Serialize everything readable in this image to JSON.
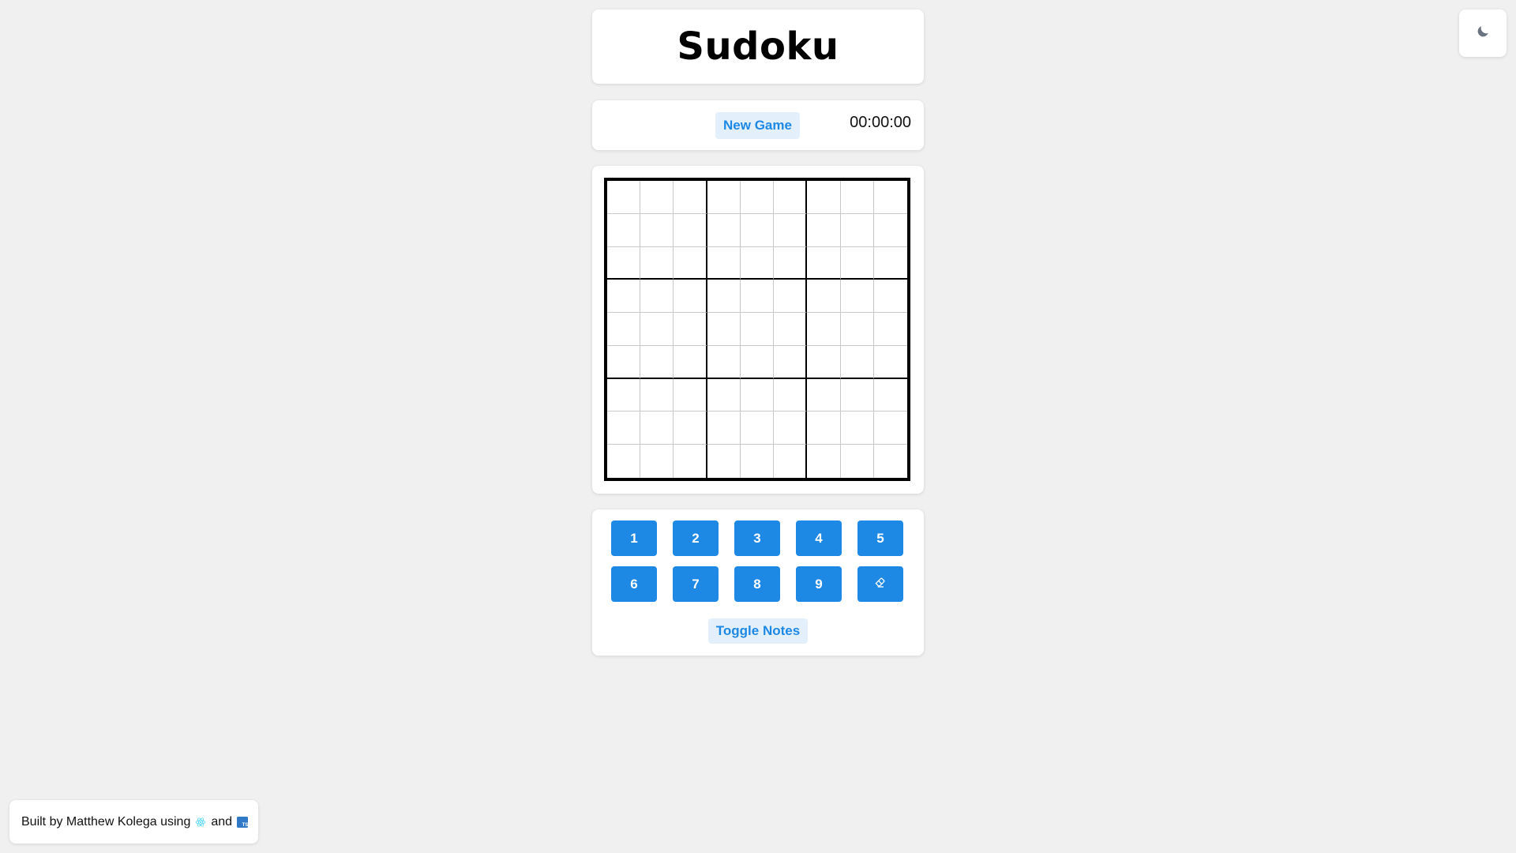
{
  "title": "Sudoku",
  "controls": {
    "new_game_label": "New Game",
    "timer": "00:00:00"
  },
  "board": {
    "size": 9,
    "cells": [
      [
        "",
        "",
        "",
        "",
        "",
        "",
        "",
        "",
        ""
      ],
      [
        "",
        "",
        "",
        "",
        "",
        "",
        "",
        "",
        ""
      ],
      [
        "",
        "",
        "",
        "",
        "",
        "",
        "",
        "",
        ""
      ],
      [
        "",
        "",
        "",
        "",
        "",
        "",
        "",
        "",
        ""
      ],
      [
        "",
        "",
        "",
        "",
        "",
        "",
        "",
        "",
        ""
      ],
      [
        "",
        "",
        "",
        "",
        "",
        "",
        "",
        "",
        ""
      ],
      [
        "",
        "",
        "",
        "",
        "",
        "",
        "",
        "",
        ""
      ],
      [
        "",
        "",
        "",
        "",
        "",
        "",
        "",
        "",
        ""
      ],
      [
        "",
        "",
        "",
        "",
        "",
        "",
        "",
        "",
        ""
      ]
    ]
  },
  "number_pad": {
    "numbers": [
      "1",
      "2",
      "3",
      "4",
      "5",
      "6",
      "7",
      "8",
      "9"
    ],
    "erase_icon": "eraser-icon",
    "toggle_notes_label": "Toggle Notes"
  },
  "theme_toggle": {
    "icon": "moon-icon"
  },
  "footer": {
    "text_before": "Built by Matthew Kolega using",
    "text_and": "and",
    "react_icon": "react-icon",
    "typescript_icon": "typescript-icon",
    "typescript_icon_text": "TS"
  },
  "colors": {
    "accent": "#1e88e5",
    "accent_light": "#e3f0fb",
    "background": "#f0f0f0"
  }
}
